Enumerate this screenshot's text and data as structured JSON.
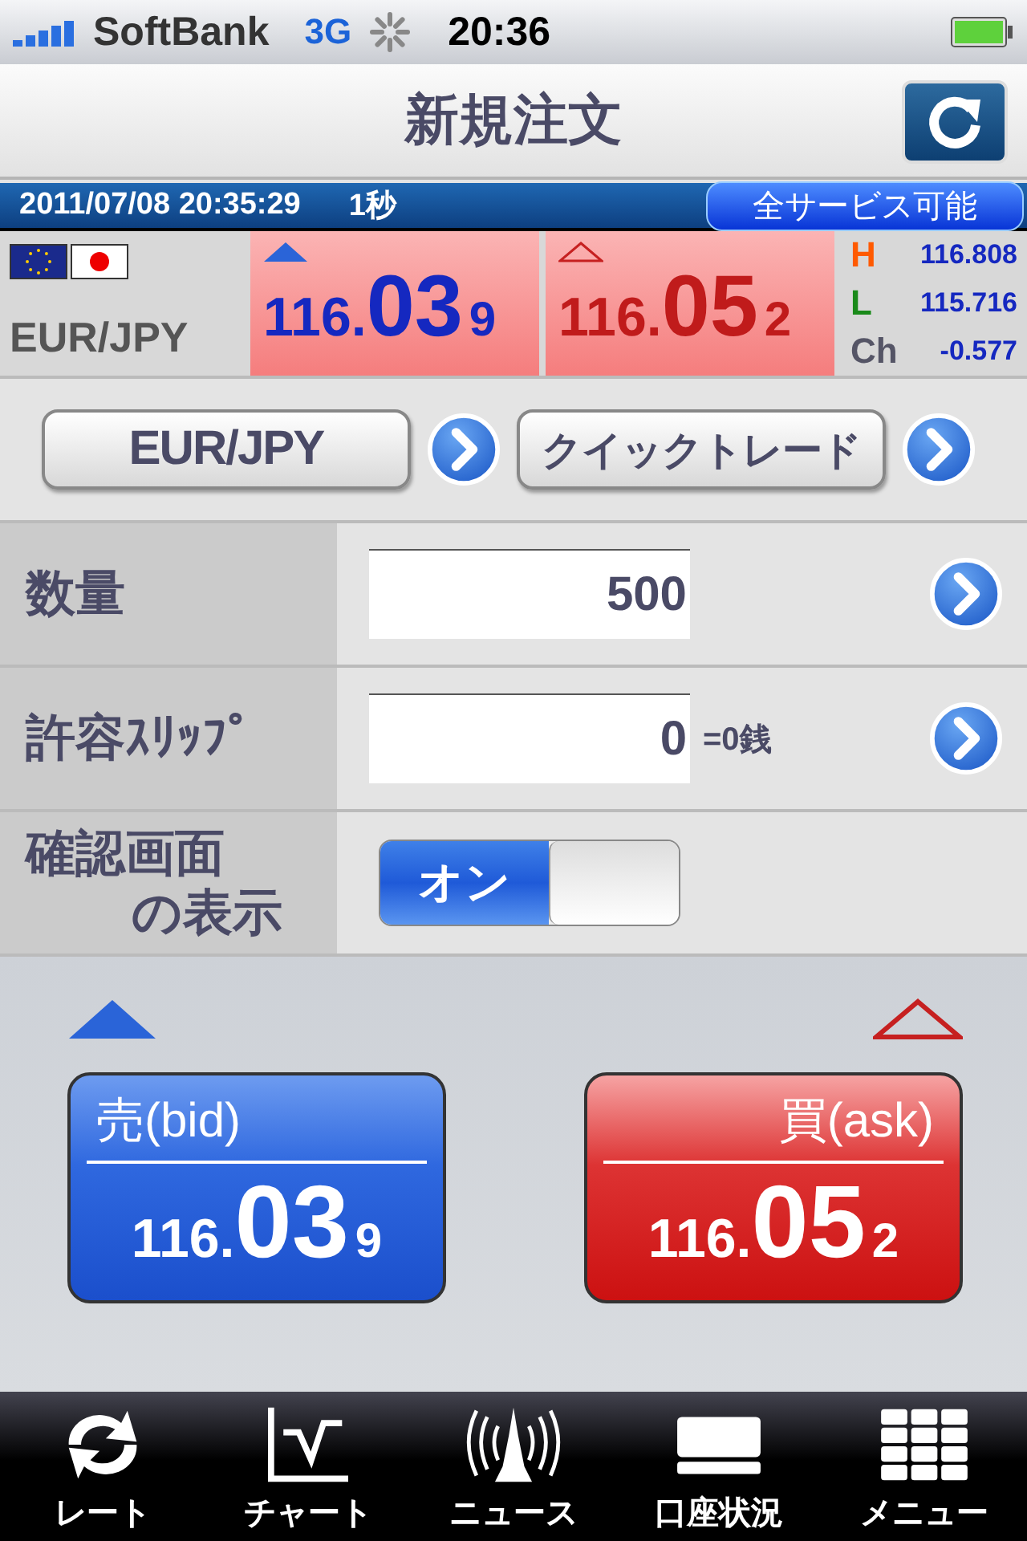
{
  "status_bar": {
    "carrier": "SoftBank",
    "network": "3G",
    "time": "20:36"
  },
  "nav": {
    "title": "新規注文"
  },
  "info_bar": {
    "datetime": "2011/07/08  20:35:29",
    "interval": "1秒",
    "status": "全サービス可能"
  },
  "quote": {
    "pair": "EUR/JPY",
    "prices": [
      {
        "kind": "bid",
        "prefix": "116.",
        "big": "03",
        "small": "9"
      },
      {
        "kind": "ask",
        "prefix": "116.",
        "big": "05",
        "small": "2"
      }
    ],
    "stats": [
      {
        "label": "H",
        "value": "116.808",
        "color": "#ff5a00"
      },
      {
        "label": "L",
        "value": "115.716",
        "color": "#1a8a1a"
      },
      {
        "label": "Ch",
        "value": "-0.577",
        "color": "#555566"
      }
    ]
  },
  "selectors": [
    {
      "label": "EUR/JPY"
    },
    {
      "label": "クイックトレード"
    }
  ],
  "form": [
    {
      "kind": "input",
      "label": [
        "数量"
      ],
      "value": "500"
    },
    {
      "kind": "input",
      "label": [
        "許容ｽﾘｯﾌﾟ"
      ],
      "value": "0",
      "note": "=0銭"
    },
    {
      "kind": "toggle",
      "label": [
        "確認画面",
        "の表示"
      ],
      "on": true,
      "on_label": "オン"
    }
  ],
  "trade": [
    {
      "kind": "sell",
      "label": "売(bid)",
      "prefix": "116.",
      "big": "03",
      "small": "9"
    },
    {
      "kind": "buy",
      "label": "買(ask)",
      "prefix": "116.",
      "big": "05",
      "small": "2"
    }
  ],
  "tabs": [
    {
      "kind": "rate",
      "label": "レート"
    },
    {
      "kind": "chart",
      "label": "チャート"
    },
    {
      "kind": "news",
      "label": "ニュース"
    },
    {
      "kind": "account",
      "label": "口座状況"
    },
    {
      "kind": "menu",
      "label": "メニュー"
    }
  ]
}
